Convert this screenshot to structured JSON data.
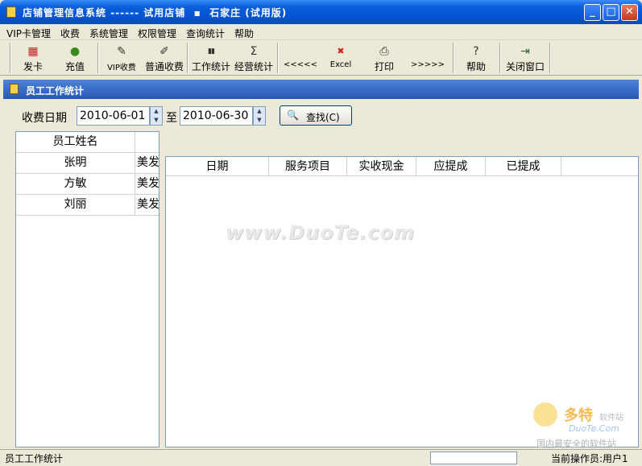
{
  "window": {
    "title": "店铺管理信息系统 ------ 试用店铺  ▪  石家庄 (试用版)",
    "minimize": "_",
    "maximize": "□",
    "close": "✕"
  },
  "menu": [
    "VIP卡管理",
    "收费",
    "系统管理",
    "权限管理",
    "查询统计",
    "帮助"
  ],
  "toolbar": [
    {
      "icon": "card-icon",
      "glyph": "▦",
      "label": "发卡"
    },
    {
      "icon": "money-bag-icon",
      "glyph": "●",
      "label": "充值"
    },
    {
      "icon": "pencil-icon",
      "glyph": "✎",
      "label": "VIP收费"
    },
    {
      "icon": "brush-icon",
      "glyph": "✐",
      "label": "普通收费"
    },
    {
      "icon": "bar-chart-icon",
      "glyph": "▮▮",
      "label": "工作统计"
    },
    {
      "icon": "sigma-icon",
      "glyph": "Σ",
      "label": "经营统计"
    },
    {
      "icon": "prev-page-icon",
      "glyph": "",
      "label": "<<<<<"
    },
    {
      "icon": "excel-icon",
      "glyph": "✖",
      "label": "Excel"
    },
    {
      "icon": "printer-icon",
      "glyph": "⎙",
      "label": "打印"
    },
    {
      "icon": "next-page-icon",
      "glyph": "",
      "label": ">>>>>"
    },
    {
      "icon": "help-icon",
      "glyph": "?",
      "label": "帮助"
    },
    {
      "icon": "exit-icon",
      "glyph": "⇥",
      "label": "关闭窗口"
    }
  ],
  "panel": {
    "title": "员工工作统计"
  },
  "filter": {
    "label": "收费日期",
    "from": "2010-06-01",
    "to_label": "至",
    "to": "2010-06-30",
    "search_label": "查找(C)",
    "search_icon": "🔍"
  },
  "employees": {
    "header": "员工姓名",
    "rows": [
      {
        "name": "张明",
        "dept": "美发"
      },
      {
        "name": "方敏",
        "dept": "美发"
      },
      {
        "name": "刘丽",
        "dept": "美发"
      }
    ]
  },
  "detail": {
    "columns": [
      "日期",
      "服务项目",
      "实收现金",
      "应提成",
      "已提成"
    ]
  },
  "watermark": {
    "text": "www.DuoTe.com",
    "logo_main": "多特",
    "logo_sub": "软件站",
    "logo_url": "DuoTe.Com",
    "logo_tag": "国内最安全的软件站"
  },
  "status": {
    "left": "员工工作统计",
    "right": "当前操作员:用户1"
  }
}
